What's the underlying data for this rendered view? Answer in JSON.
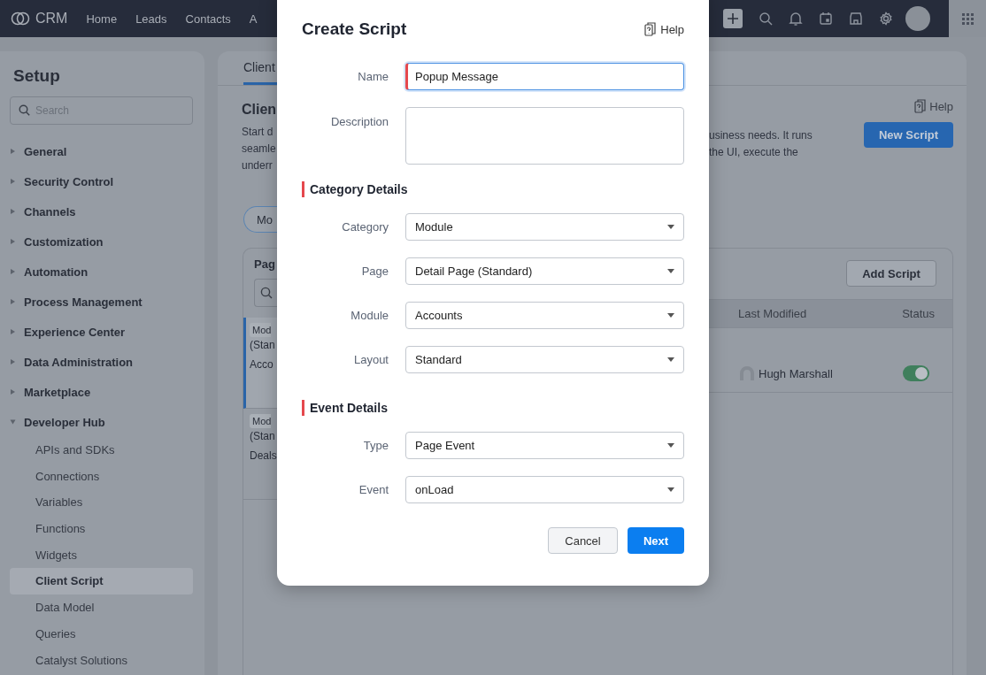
{
  "topbar": {
    "logo": "CRM",
    "nav": [
      {
        "label": "Home"
      },
      {
        "label": "Leads"
      },
      {
        "label": "Contacts"
      },
      {
        "label": "A"
      }
    ]
  },
  "sidebar": {
    "title": "Setup",
    "search": {
      "placeholder": "Search"
    },
    "items": [
      {
        "label": "General",
        "expanded": false
      },
      {
        "label": "Security Control",
        "expanded": false
      },
      {
        "label": "Channels",
        "expanded": false
      },
      {
        "label": "Customization",
        "expanded": false
      },
      {
        "label": "Automation",
        "expanded": false
      },
      {
        "label": "Process Management",
        "expanded": false
      },
      {
        "label": "Experience Center",
        "expanded": false
      },
      {
        "label": "Data Administration",
        "expanded": false
      },
      {
        "label": "Marketplace",
        "expanded": false
      },
      {
        "label": "Developer Hub",
        "expanded": true,
        "children": [
          {
            "label": "APIs and SDKs",
            "selected": false
          },
          {
            "label": "Connections",
            "selected": false
          },
          {
            "label": "Variables",
            "selected": false
          },
          {
            "label": "Functions",
            "selected": false
          },
          {
            "label": "Widgets",
            "selected": false
          },
          {
            "label": "Client Script",
            "selected": true
          },
          {
            "label": "Data Model",
            "selected": false
          },
          {
            "label": "Queries",
            "selected": false
          },
          {
            "label": "Catalyst Solutions",
            "selected": false
          }
        ]
      }
    ]
  },
  "main": {
    "tab": "Client",
    "heading": "Clien",
    "description_left": [
      "Start d",
      "seamle",
      "underr"
    ],
    "description_right": [
      "usiness needs. It runs",
      "the UI, execute the"
    ],
    "help": "Help",
    "new_script": "New Script",
    "filter_pill": "Mo",
    "pages_panel": {
      "title": "Pag",
      "items": [
        {
          "tag": "Mod",
          "page": "(Stan",
          "module": "Acco",
          "selected": true
        },
        {
          "tag": "Mod",
          "page": "(Stan",
          "module": "Deals",
          "selected": false
        }
      ]
    },
    "add_script": "Add Script",
    "table": {
      "columns": [
        "Last Modified",
        "Status"
      ],
      "rows": [
        {
          "last_modified": "Hugh Marshall",
          "status_on": true
        }
      ]
    }
  },
  "dialog": {
    "title": "Create Script",
    "help": "Help",
    "fields": [
      {
        "label": "Name",
        "kind": "text",
        "value": "Popup Message",
        "required": true,
        "focused": true
      },
      {
        "label": "Description",
        "kind": "textarea",
        "required": false,
        "focused": false
      }
    ],
    "sections": [
      {
        "title": "Category Details",
        "fields": [
          {
            "label": "Category",
            "kind": "select",
            "value": "Module"
          },
          {
            "label": "Page",
            "kind": "select",
            "value": "Detail Page (Standard)"
          },
          {
            "label": "Module",
            "kind": "select",
            "value": "Accounts"
          },
          {
            "label": "Layout",
            "kind": "select",
            "value": "Standard"
          }
        ]
      },
      {
        "title": "Event Details",
        "fields": [
          {
            "label": "Type",
            "kind": "select",
            "value": "Page Event"
          },
          {
            "label": "Event",
            "kind": "select",
            "value": "onLoad"
          }
        ]
      }
    ],
    "buttons": [
      {
        "label": "Cancel",
        "kind": "secondary"
      },
      {
        "label": "Next",
        "kind": "primary"
      }
    ]
  }
}
